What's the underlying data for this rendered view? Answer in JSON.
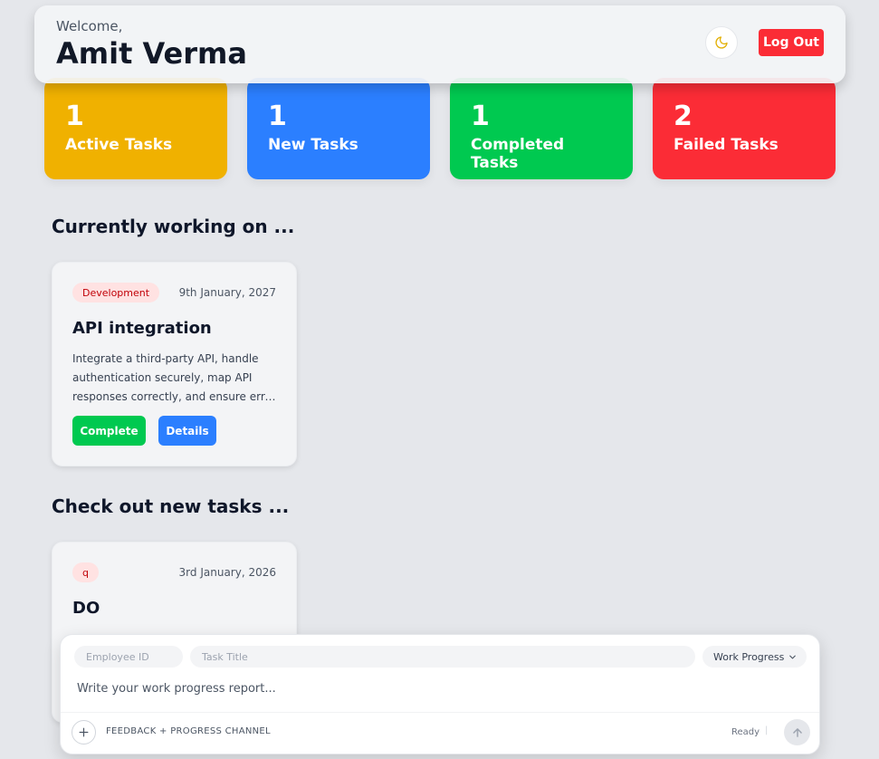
{
  "header": {
    "welcome": "Welcome,",
    "user_name": "Amit Verma",
    "theme_icon": "moon-icon",
    "logout_label": "Log Out"
  },
  "stats": [
    {
      "value": "1",
      "label": "Active Tasks",
      "color": "#f0b100"
    },
    {
      "value": "1",
      "label": "New Tasks",
      "color": "#2b7fff"
    },
    {
      "value": "1",
      "label": "Completed Tasks",
      "color": "#00c950"
    },
    {
      "value": "2",
      "label": "Failed Tasks",
      "color": "#fb2c36"
    }
  ],
  "sections": {
    "current_title": "Currently working on ...",
    "new_title": "Check out new tasks ..."
  },
  "current_task": {
    "category": "Development",
    "date": "9th January, 2027",
    "title": "API integration",
    "description": "Integrate a third-party API, handle authentication securely, map API responses correctly, and ensure error handling is in place.",
    "complete_label": "Complete",
    "details_label": "Details"
  },
  "new_task": {
    "category": "q",
    "date": "3rd January, 2026",
    "title": "DO"
  },
  "composer": {
    "employee_id_placeholder": "Employee ID",
    "task_title_placeholder": "Task Title",
    "type_selected": "Work Progress",
    "report_placeholder": "Write your work progress report...",
    "channel_label": "FEEDBACK + PROGRESS CHANNEL",
    "status": "Ready",
    "status_separator": "|"
  },
  "colors": {
    "background": "#e5e7eb",
    "accent_green": "#00c950",
    "accent_blue": "#2b7fff",
    "accent_red": "#fb2c36",
    "accent_yellow": "#f0b100"
  }
}
